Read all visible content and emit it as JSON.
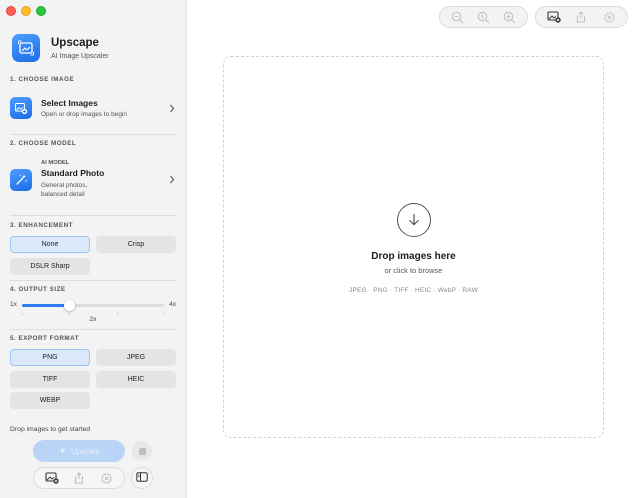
{
  "window": {
    "traffic_lights": [
      "close",
      "minimize",
      "zoom"
    ],
    "colors": {
      "close": "#ff5f57",
      "minimize": "#febc2e",
      "zoom": "#28c840"
    }
  },
  "sidebar": {
    "app": {
      "title": "Upscape",
      "subtitle": "AI Image Upscaler",
      "icon": "photo-resize-icon"
    },
    "choose_image": {
      "label": "1. CHOOSE IMAGE",
      "card": {
        "title": "Select Images",
        "subtitle": "Open or drop images to begin",
        "icon": "photo-add-icon"
      }
    },
    "choose_model": {
      "label": "2. CHOOSE MODEL",
      "card": {
        "eyebrow": "AI MODEL",
        "title": "Standard Photo",
        "subtitle_line1": "General photos,",
        "subtitle_line2": "balanced detail",
        "icon": "magic-wand-icon"
      }
    },
    "enhancement": {
      "label": "3. ENHANCEMENT",
      "options": [
        "None",
        "Crisp",
        "DSLR Sharp"
      ],
      "selected": "None"
    },
    "output_size": {
      "label": "4. OUTPUT SIZE",
      "min_label": "1x",
      "max_label": "4x",
      "value_label": "2x",
      "min": 1,
      "max": 4,
      "value": 2
    },
    "export_format": {
      "label": "5. EXPORT FORMAT",
      "options": [
        "PNG",
        "JPEG",
        "TIFF",
        "HEIC",
        "WEBP"
      ],
      "selected": "PNG"
    },
    "status": "Drop images to get started",
    "upscale_button": {
      "label": "Upscale",
      "icon": "sparkle-icon",
      "enabled": false
    },
    "stop_button": {
      "icon": "stop-icon",
      "enabled": false
    },
    "bottom_actions": [
      "photo-add-icon",
      "share-icon",
      "clear-icon"
    ],
    "sidebar_toggle_icon": "sidebar-icon"
  },
  "toolbar": {
    "zoom_group": [
      "zoom-out-icon",
      "zoom-reset-icon",
      "zoom-in-icon"
    ],
    "file_group": [
      "photo-add-icon",
      "share-icon",
      "clear-icon"
    ]
  },
  "dropzone": {
    "title": "Drop images here",
    "subtitle": "or click to browse",
    "formats": "JPEG · PNG · TIFF · HEIC · WebP · RAW",
    "icon": "arrow-down-circle-icon"
  },
  "accent_color": "#2f7cf6"
}
